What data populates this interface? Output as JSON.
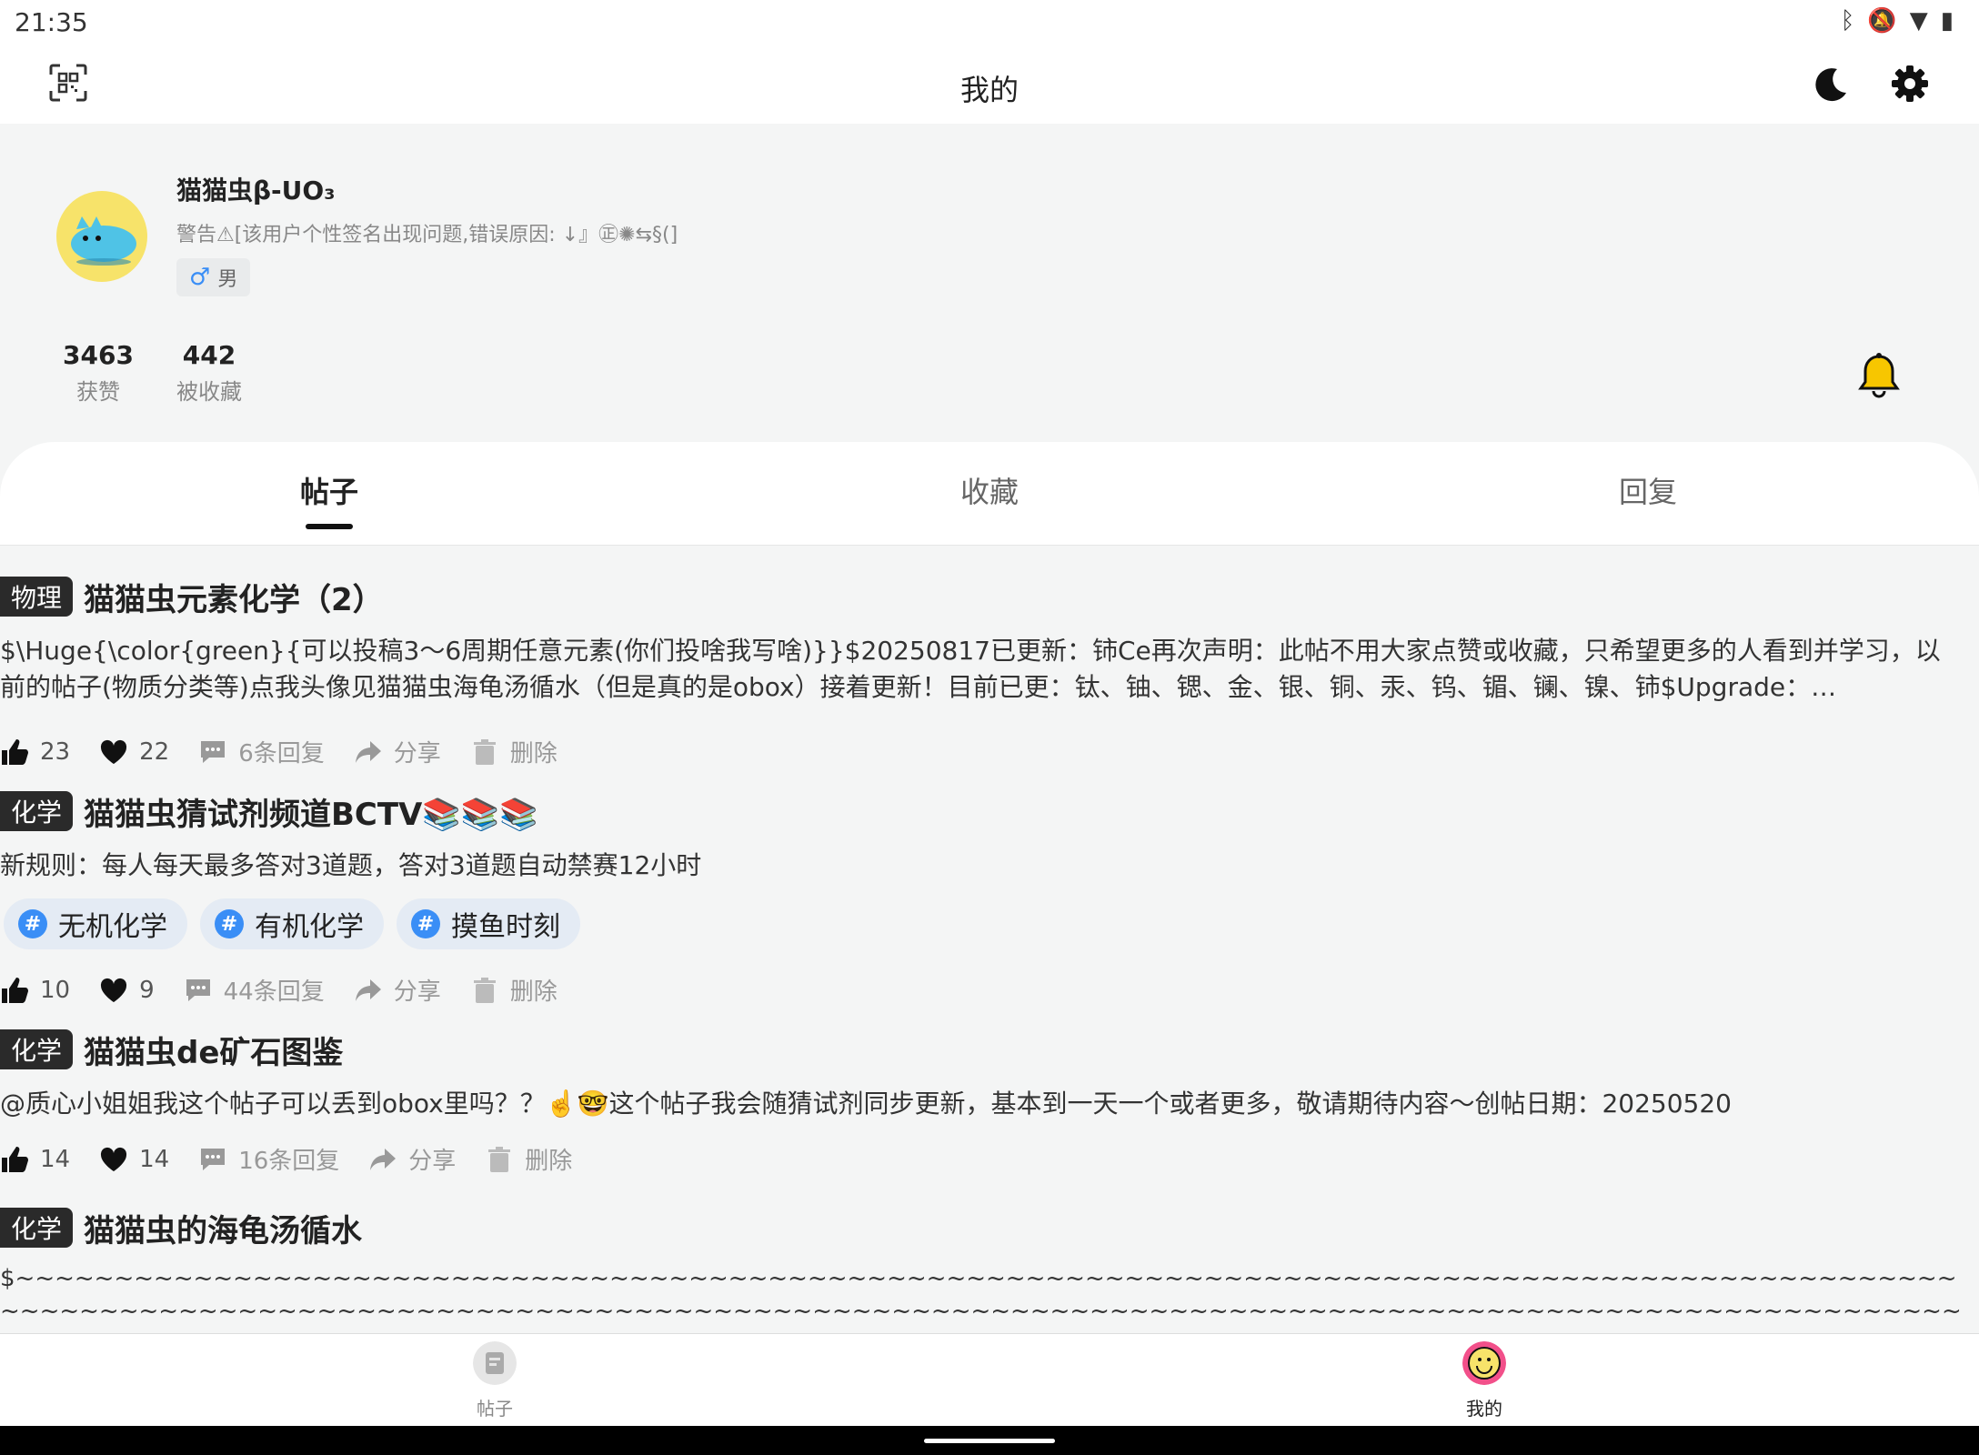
{
  "status": {
    "time": "21:35"
  },
  "header": {
    "title": "我的"
  },
  "profile": {
    "name": "猫猫虫β-UO₃",
    "signature": "警告⚠[该用户个性签名出现问题,错误原因: ↓』㊣✺⇆§(]",
    "gender_symbol": "♂",
    "gender": "男",
    "stats": [
      {
        "value": "3463",
        "label": "获赞"
      },
      {
        "value": "442",
        "label": "被收藏"
      }
    ]
  },
  "tabs": [
    "帖子",
    "收藏",
    "回复"
  ],
  "active_tab": "帖子",
  "posts": [
    {
      "tag": "物理",
      "title": "猫猫虫元素化学（2）",
      "body": "$\\Huge{\\color{green}{可以投稿3～6周期任意元素(你们投啥我写啥)}}$20250817已更新：铈Ce再次声明：此帖不用大家点赞或收藏，只希望更多的人看到并学习，以前的帖子(物质分类等)点我头像见猫猫虫海龟汤循水（但是真的是obox）接着更新！目前已更：钛、铀、锶、金、银、铜、汞、钨、镅、镧、镍、铈$Upgrade：…",
      "likes": "23",
      "favorites": "22",
      "replies": "6条回复",
      "share": "分享",
      "delete": "删除"
    },
    {
      "tag": "化学",
      "title": "猫猫虫猜试剂频道BCTV📚📚📚",
      "body": "新规则：每人每天最多答对3道题，答对3道题自动禁赛12小时",
      "topics": [
        "无机化学",
        "有机化学",
        "摸鱼时刻"
      ],
      "likes": "10",
      "favorites": "9",
      "replies": "44条回复",
      "share": "分享",
      "delete": "删除"
    },
    {
      "tag": "化学",
      "title": "猫猫虫de矿石图鉴",
      "body": "@质心小姐姐我这个帖子可以丢到obox里吗？？☝️🤓这个帖子我会随猜试剂同步更新，基本到一天一个或者更多，敬请期待内容～创帖日期：20250520",
      "likes": "14",
      "favorites": "14",
      "replies": "16条回复",
      "share": "分享",
      "delete": "删除"
    },
    {
      "tag": "化学",
      "title": "猫猫虫的海龟汤循水",
      "body": "$~~~~~~~~~~~~~~~~~~~~~~~~~~~~~~~~~~~~~~~~~~~~~~~~~~~~~~~~~~~~~~~~~~~~~~~~~~~~~~~~~~~~~~~~~~~~~~~~~~~~~~~~~~~~~~~~~~~~~~~~~~~~~~~~~~~~~~~~~~~~~~~~~~~~~~~~~~~~~~~~~~~~~~~~~~~~~~~~~~~~~~~~~~~~~~~~~~~~~~~~~~~~~~~~~~~~~~~~~~~~~~~~~~~~~~~~~~~~~~~~~~~~~~~…"
    }
  ],
  "bottom_nav": [
    {
      "label": "帖子"
    },
    {
      "label": "我的"
    }
  ],
  "colors": {
    "accent": "#3a8ef6",
    "bell": "#f7c600",
    "avatar_bg": "#f7e36a",
    "me_icon": "#f2508a"
  }
}
